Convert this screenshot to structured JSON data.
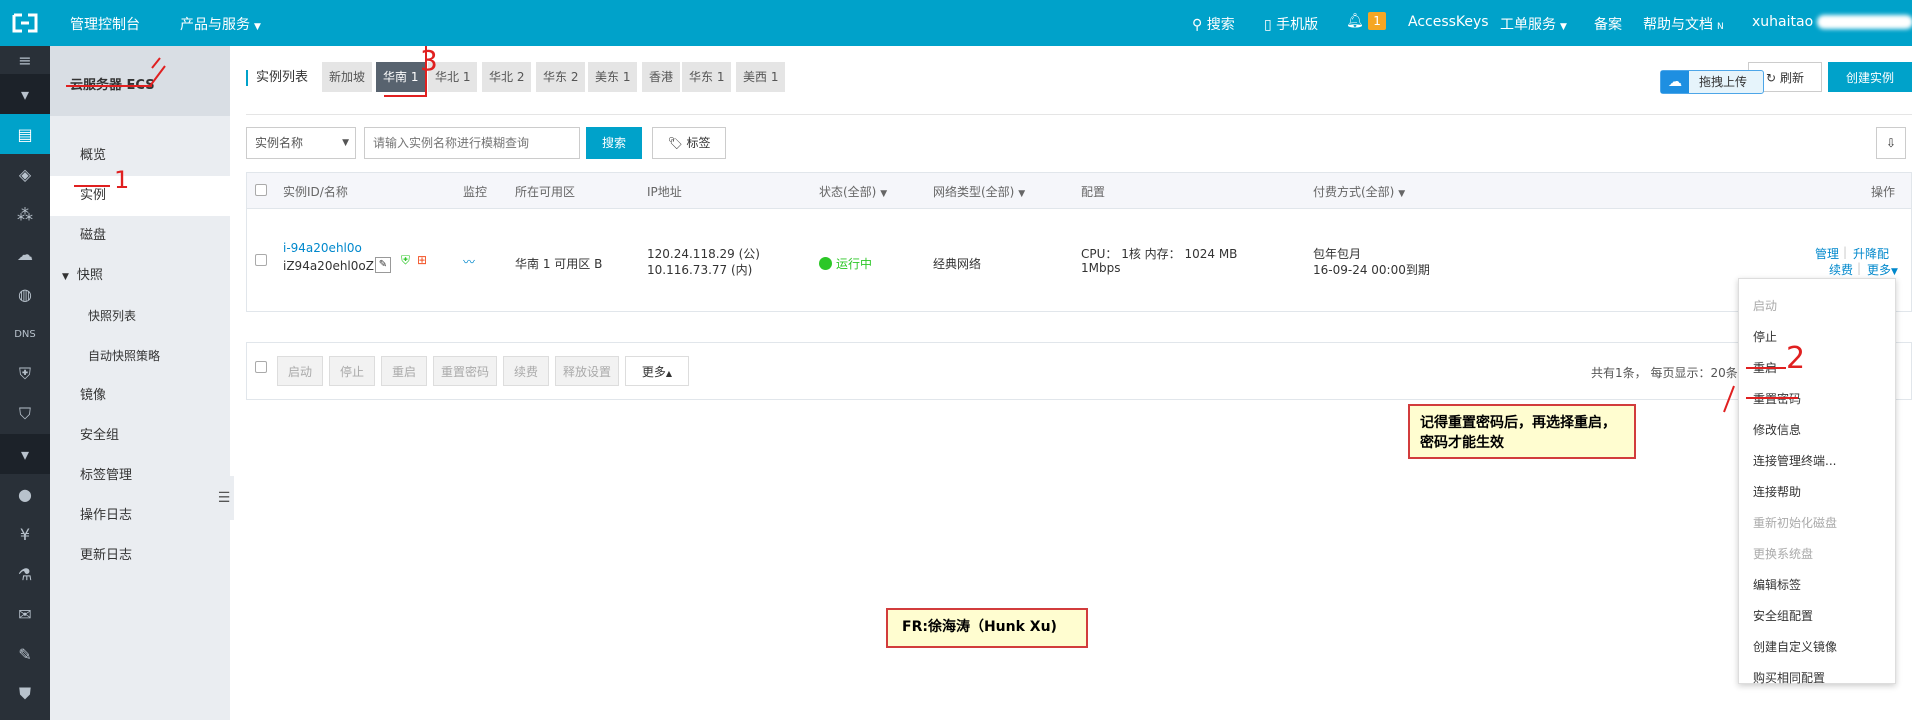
{
  "topbar": {
    "console": "管理控制台",
    "products": "产品与服务",
    "search": "搜索",
    "mobile": "手机版",
    "notify_count": "1",
    "accesskeys": "AccessKeys",
    "tickets": "工单服务",
    "beian": "备案",
    "help": "帮助与文档",
    "user": "xuhaitao"
  },
  "sidebar": {
    "title": "云服务器 ECS",
    "items": [
      "概览",
      "实例",
      "磁盘",
      "快照",
      "快照列表",
      "自动快照策略",
      "镜像",
      "安全组",
      "标签管理",
      "操作日志",
      "更新日志"
    ]
  },
  "regions": {
    "label": "实例列表",
    "tabs": [
      "新加坡",
      "华南 1",
      "华北 1",
      "华北 2",
      "华东 2",
      "美东 1",
      "香港",
      "华东 1",
      "美西 1"
    ]
  },
  "actions": {
    "upload": "拖拽上传",
    "refresh": "刷新",
    "create": "创建实例"
  },
  "filter": {
    "select": "实例名称",
    "placeholder": "请输入实例名称进行模糊查询",
    "search": "搜索",
    "tag": "标签"
  },
  "table": {
    "headers": [
      "实例ID/名称",
      "监控",
      "所在可用区",
      "IP地址",
      "状态(全部)",
      "网络类型(全部)",
      "配置",
      "付费方式(全部)",
      "操作"
    ],
    "row": {
      "id": "i-94a20ehl0o",
      "name": "iZ94a20ehl0oZ",
      "zone": "华南 1 可用区 B",
      "ip_public": "120.24.118.29 (公)",
      "ip_private": "10.116.73.77 (内)",
      "status": "运行中",
      "network": "经典网络",
      "config_line1": "CPU： 1核    内存： 1024 MB",
      "config_line2": "1Mbps",
      "pay_line1": "包年包月",
      "pay_line2": "16-09-24 00:00到期",
      "op_manage": "管理",
      "op_upgrade": "升降配",
      "op_renew": "续费",
      "op_more": "更多"
    }
  },
  "bulk": {
    "buttons": [
      "启动",
      "停止",
      "重启",
      "重置密码",
      "续费",
      "释放设置"
    ],
    "more": "更多",
    "summary": "共有1条， 每页显示：20条"
  },
  "more_menu": {
    "items": [
      {
        "label": "启动",
        "disabled": true
      },
      {
        "label": "停止",
        "disabled": false
      },
      {
        "label": "重启",
        "disabled": false
      },
      {
        "label": "重置密码",
        "disabled": false
      },
      {
        "label": "修改信息",
        "disabled": false
      },
      {
        "label": "连接管理终端...",
        "disabled": false
      },
      {
        "label": "连接帮助",
        "disabled": false
      },
      {
        "label": "重新初始化磁盘",
        "disabled": true
      },
      {
        "label": "更换系统盘",
        "disabled": true
      },
      {
        "label": "编辑标签",
        "disabled": false
      },
      {
        "label": "安全组配置",
        "disabled": false
      },
      {
        "label": "创建自定义镜像",
        "disabled": false
      },
      {
        "label": "购买相同配置",
        "disabled": false
      }
    ]
  },
  "annotations": {
    "note": "记得重置密码后，再选择重启，密码才能生效",
    "credit": "FR:徐海涛（Hunk Xu)",
    "marks": {
      "step1": "1",
      "step2": "2",
      "step3": "3"
    }
  },
  "colors": {
    "topbar": "#00a2ca",
    "accent": "#00a2ca",
    "running": "#2cc727",
    "note_border": "#d23c3c"
  }
}
